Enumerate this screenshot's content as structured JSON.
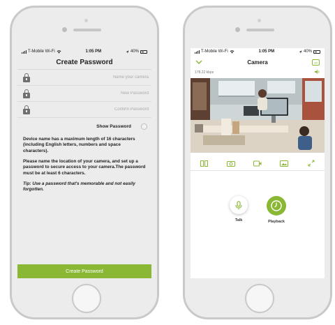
{
  "colors": {
    "accent": "#8ab734",
    "icon_gray": "#6f6f6f",
    "background": "#ececec"
  },
  "create_password_screen": {
    "status_bar": {
      "carrier": "T-Mobile Wi-Fi",
      "time": "1:05 PM",
      "battery": "40%"
    },
    "title": "Create Password",
    "fields": [
      {
        "icon": "lock-icon",
        "placeholder": "Name your camera"
      },
      {
        "icon": "lock-icon",
        "placeholder": "New Password"
      },
      {
        "icon": "lock-icon",
        "placeholder": "Confirm Password"
      }
    ],
    "show_password_label": "Show Password",
    "info_paragraphs": [
      "Device name has a maximum length of 16 characters (including English letters, numbers and space characters).",
      "Please name the location of your camera, and set up a password to secure access to your camera.The password must be at least 6 characters."
    ],
    "tip": "Tip: Use a password that's memorable and not easily forgotten.",
    "create_button_label": "Create Password"
  },
  "camera_screen": {
    "status_bar": {
      "carrier": "T-Mobile Wi-Fi",
      "time": "1:05 PM",
      "battery": "40%"
    },
    "title": "Camera",
    "bitrate": "178.22 kbps",
    "toolbar_icons": [
      "split-view-icon",
      "snapshot-icon",
      "record-icon",
      "gallery-icon",
      "fullscreen-icon"
    ],
    "talk_label": "Talk",
    "playback_label": "Playback"
  }
}
